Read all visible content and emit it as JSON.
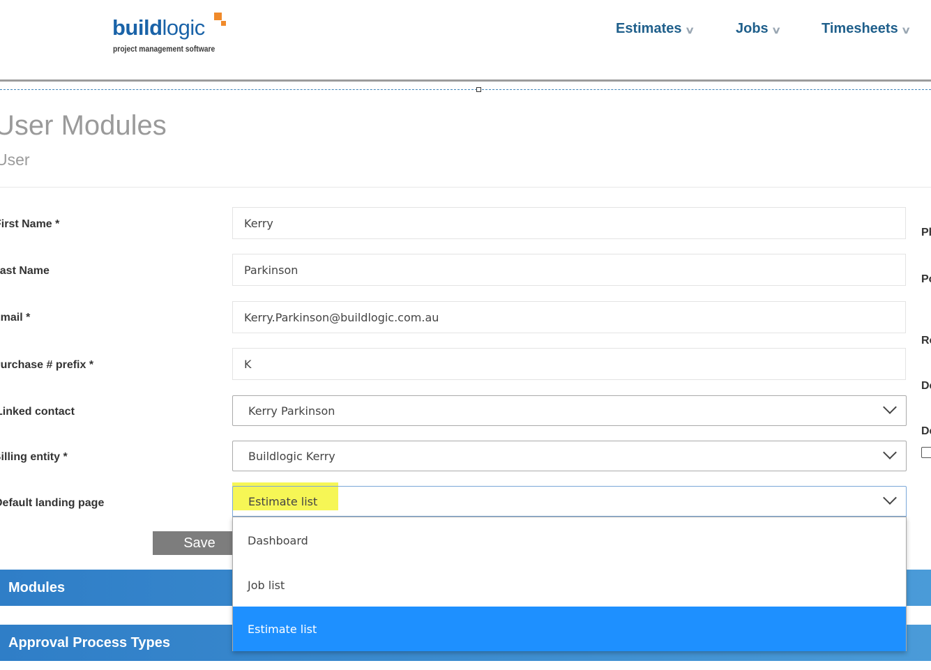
{
  "header": {
    "logo": {
      "word_bold": "build",
      "word_light": "logic",
      "tagline": "project management software"
    },
    "nav": [
      {
        "label": "Estimates"
      },
      {
        "label": "Jobs"
      },
      {
        "label": "Timesheets"
      }
    ]
  },
  "page": {
    "title": "User Modules",
    "subtitle": "User"
  },
  "form": {
    "first_name": {
      "label": "First Name *",
      "value": "Kerry"
    },
    "last_name": {
      "label": "Last Name",
      "value": "Parkinson"
    },
    "email": {
      "label": "Email *",
      "value": "Kerry.Parkinson@buildlogic.com.au"
    },
    "purchase_prefix": {
      "label": "Purchase # prefix *",
      "value": "K"
    },
    "linked_contact": {
      "label": "Linked contact",
      "value": "Kerry Parkinson"
    },
    "billing_entity": {
      "label": "Billing entity *",
      "value": "Buildlogic Kerry"
    },
    "landing_page": {
      "label": "Default landing page",
      "value": "Estimate list",
      "options": [
        "Dashboard",
        "Job list",
        "Estimate list"
      ],
      "selected_index": 2
    },
    "save_label": "Save"
  },
  "right_column_labels": [
    "Ph",
    "Po",
    "Ro",
    "De",
    "De"
  ],
  "sections": {
    "modules": "Modules",
    "approval": "Approval Process Types"
  },
  "colors": {
    "brand_blue": "#1a63a8",
    "brand_orange": "#f08a2a",
    "nav_text": "#1f5f8b",
    "band_blue": "#3a8bd0",
    "option_selected": "#1e90ff",
    "highlight": "#f5f542"
  },
  "icons": {
    "nav_chevron": "chevron-down-icon",
    "select_caret": "chevron-down-icon"
  }
}
